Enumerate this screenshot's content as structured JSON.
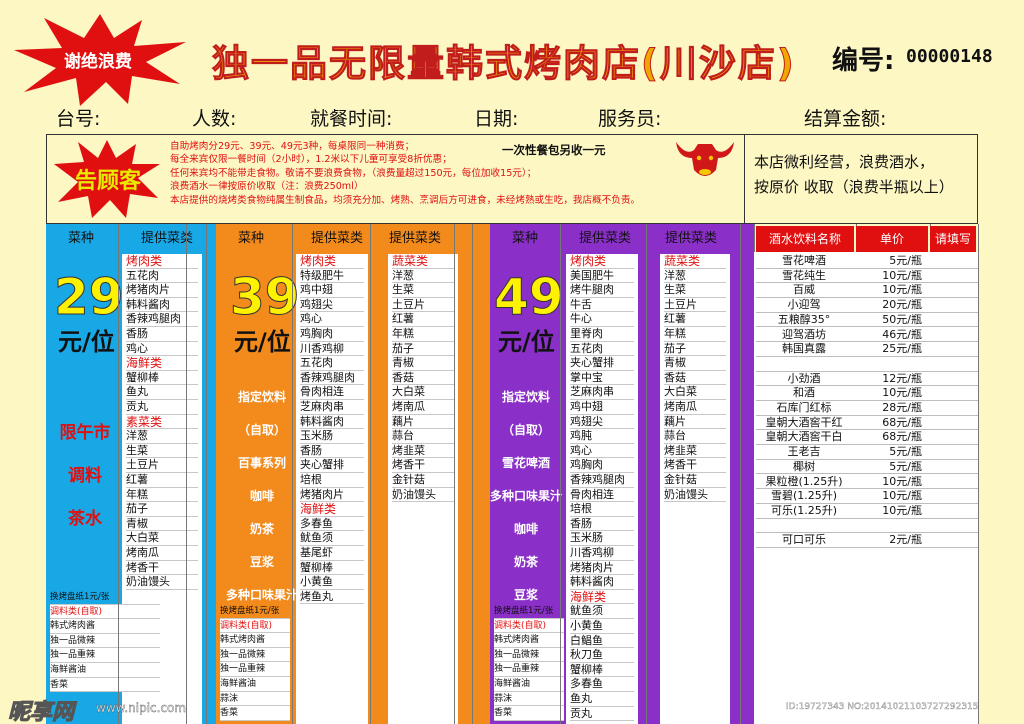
{
  "header": {
    "burst": "谢绝浪费",
    "title": "独一品无限量韩式烤肉店(川沙店)",
    "serial_label": "编号:",
    "serial_value": "00000148",
    "fields": [
      "台号:",
      "人数:",
      "就餐时间:",
      "日期:",
      "服务员:",
      "结算金额:"
    ]
  },
  "notice": {
    "burst": "告顾客",
    "lines": [
      "自助烤肉分29元、39元、49元3种，每桌限同一种消费；",
      "每全来宾仅限一餐时间（2小时），1.2米以下儿童可享受8折优惠；",
      "任何来宾均不能带走食物。敬请不要浪费食物，（浪费量超过150元，每位加收15元）；",
      "浪费酒水一律按原价收取（注：浪费250ml）",
      "本店提供的烧烤类食物纯属生制食品，均须充分加、烤熟、烹调后方可进食，未经烤熟或生吃，我店概不负责。"
    ],
    "package_fee": "一次性餐包另收一元",
    "policy": [
      "本店微利经营，浪费酒水，",
      "按原价 收取（浪费半瓶以上）"
    ]
  },
  "sections": [
    {
      "color": "#19a8e6",
      "headers": [
        "菜种",
        "提供菜类"
      ],
      "price": "29",
      "per": "元/位",
      "side": [
        "限午市",
        "调料",
        "茶水"
      ],
      "side_color": "#e01010",
      "items": [
        {
          "t": "烤肉类",
          "c": 1
        },
        "五花肉",
        "烤猪肉片",
        "韩料酱肉",
        "香辣鸡腿肉",
        "香肠",
        "鸡心",
        {
          "t": "海鲜类",
          "c": 1
        },
        "蟹柳棒",
        "鱼丸",
        "贡丸",
        {
          "t": "素菜类",
          "c": 1
        },
        "洋葱",
        "生菜",
        "土豆片",
        "红薯",
        "年糕",
        "茄子",
        "青椒",
        "大白菜",
        "烤南瓜",
        "烤香干",
        "奶油馒头"
      ],
      "footer": [
        "换烤盘纸1元/张",
        {
          "t": "调料类(自取)",
          "c": 1
        },
        "韩式烤肉酱",
        "独一品微辣",
        "独一品重辣",
        "海鲜酱油",
        "香菜"
      ]
    },
    {
      "color": "#f28a1c",
      "headers": [
        "菜种",
        "提供菜类",
        "提供菜类"
      ],
      "price": "39",
      "per": "元/位",
      "side": [
        "指定饮料",
        "（自取）",
        "百事系列",
        "咖啡",
        "奶茶",
        "豆浆",
        "多种口味果汁"
      ],
      "side_color": "#fff",
      "items": [
        {
          "t": "烤肉类",
          "c": 1
        },
        "特级肥牛",
        "鸡中翅",
        "鸡翅尖",
        "鸡心",
        "鸡胸肉",
        "川香鸡柳",
        "五花肉",
        "香辣鸡腿肉",
        "骨肉相连",
        "芝麻肉串",
        "韩料酱肉",
        "玉米肠",
        "香肠",
        "夹心蟹排",
        "培根",
        "烤猪肉片",
        {
          "t": "海鲜类",
          "c": 1
        },
        "多春鱼",
        "鱿鱼须",
        "基尾虾",
        "蟹柳棒",
        "小黄鱼",
        "烤鱼丸"
      ],
      "items2": [
        {
          "t": "蔬菜类",
          "c": 1
        },
        "洋葱",
        "生菜",
        "土豆片",
        "红薯",
        "年糕",
        "茄子",
        "青椒",
        "香菇",
        "大白菜",
        "烤南瓜",
        "藕片",
        "蒜台",
        "烤韭菜",
        "烤香干",
        "金针菇",
        "奶油馒头"
      ],
      "footer": [
        "换烤盘纸1元/张",
        {
          "t": "调料类(自取)",
          "c": 1
        },
        "韩式烤肉酱",
        "独一品微辣",
        "独一品重辣",
        "海鲜酱油",
        "蒜沫",
        "香菜"
      ]
    },
    {
      "color": "#8a2fc8",
      "headers": [
        "菜种",
        "提供菜类",
        "提供菜类"
      ],
      "price": "49",
      "per": "元/位",
      "side": [
        "指定饮料",
        "（自取）",
        "雪花啤酒",
        "多种口味果汁",
        "咖啡",
        "奶茶",
        "豆浆"
      ],
      "side_color": "#fff",
      "items": [
        {
          "t": "烤肉类",
          "c": 1
        },
        "美国肥牛",
        "烤牛腿肉",
        "牛舌",
        "牛心",
        "里脊肉",
        "五花肉",
        "夹心蟹排",
        "掌中宝",
        "芝麻肉串",
        "鸡中翅",
        "鸡翅尖",
        "鸡肫",
        "鸡心",
        "鸡胸肉",
        "香辣鸡腿肉",
        "骨肉相连",
        "培根",
        "香肠",
        "玉米肠",
        "川香鸡柳",
        "烤猪肉片",
        "韩料酱肉",
        {
          "t": "海鲜类",
          "c": 1
        },
        "鱿鱼须",
        "小黄鱼",
        "白鲳鱼",
        "秋刀鱼",
        "蟹柳棒",
        "多春鱼",
        "鱼丸",
        "贡丸"
      ],
      "items2": [
        {
          "t": "蔬菜类",
          "c": 1
        },
        "洋葱",
        "生菜",
        "土豆片",
        "红薯",
        "年糕",
        "茄子",
        "青椒",
        "香菇",
        "大白菜",
        "烤南瓜",
        "藕片",
        "蒜台",
        "烤韭菜",
        "烤香干",
        "金针菇",
        "奶油馒头"
      ],
      "footer": [
        "换烤盘纸1元/张",
        {
          "t": "调料类(自取)",
          "c": 1
        },
        "韩式烤肉酱",
        "独一品微辣",
        "独一品重辣",
        "海鲜酱油",
        "蒜沫",
        "香菜"
      ]
    }
  ],
  "beverages": {
    "headers": [
      "酒水饮料名称",
      "单价",
      "请填写"
    ],
    "rows": [
      [
        "雪花啤酒",
        "5元/瓶"
      ],
      [
        "雪花纯生",
        "10元/瓶"
      ],
      [
        "百威",
        "10元/瓶"
      ],
      [
        "小迎驾",
        "20元/瓶"
      ],
      [
        "五粮醇35°",
        "50元/瓶"
      ],
      [
        "迎驾酒坊",
        "46元/瓶"
      ],
      [
        "韩国真露",
        "25元/瓶"
      ],
      [
        "",
        ""
      ],
      [
        "小劲酒",
        "12元/瓶"
      ],
      [
        "和酒",
        "10元/瓶"
      ],
      [
        "石库门红标",
        "28元/瓶"
      ],
      [
        "皇朝大酒窖干红",
        "68元/瓶"
      ],
      [
        "皇朝大酒窖干白",
        "68元/瓶"
      ],
      [
        "王老吉",
        "5元/瓶"
      ],
      [
        "椰树",
        "5元/瓶"
      ],
      [
        "果粒橙(1.25升)",
        "10元/瓶"
      ],
      [
        "雪碧(1.25升)",
        "10元/瓶"
      ],
      [
        "可乐(1.25升)",
        "10元/瓶"
      ],
      [
        "",
        ""
      ],
      [
        "可口可乐",
        "2元/瓶"
      ]
    ]
  },
  "watermark": {
    "brand": "昵享网",
    "url": "www.nipic.com",
    "id": "ID:19727343 NO:20141021103727292315"
  }
}
